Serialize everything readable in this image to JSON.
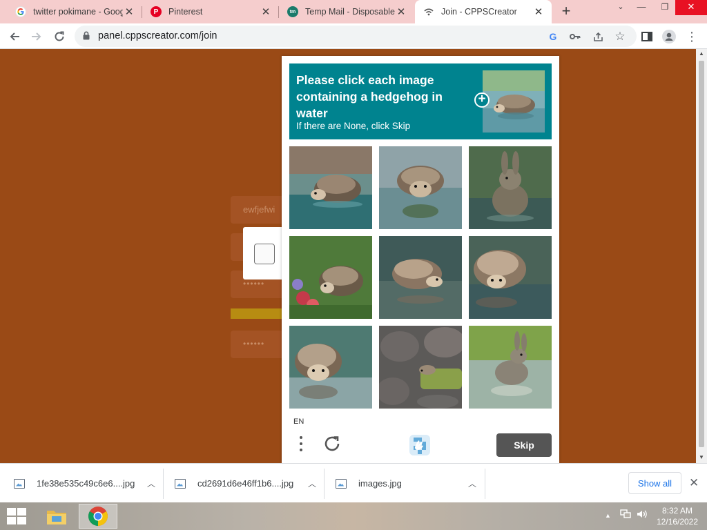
{
  "browser": {
    "tabs": [
      {
        "title": "twitter pokimane - Google",
        "favicon": "google-g-icon"
      },
      {
        "title": "Pinterest",
        "favicon": "pinterest-icon"
      },
      {
        "title": "Temp Mail - Disposable T",
        "favicon": "tempmail-icon"
      },
      {
        "title": "Join - CPPSCreator",
        "favicon": "cppscreator-icon",
        "active": true
      }
    ],
    "new_tab": "+",
    "url": "panel.cppscreator.com/join"
  },
  "page": {
    "faint_username": "ewfjefwi",
    "faint_password_1": "••••••",
    "faint_password_2": "••••••"
  },
  "captcha": {
    "prompt": "Please click each image containing a hedgehog in water",
    "subprompt": "If there are None, click Skip",
    "language": "EN",
    "skip_label": "Skip",
    "tiles": [
      {
        "subject": "hedgehog in water"
      },
      {
        "subject": "hedgehog in water"
      },
      {
        "subject": "rabbit in water"
      },
      {
        "subject": "hedgehog among flowers"
      },
      {
        "subject": "hedgehog in water"
      },
      {
        "subject": "hedgehog in water"
      },
      {
        "subject": "hedgehog in water"
      },
      {
        "subject": "hedgehog among rocks"
      },
      {
        "subject": "rabbit in water"
      }
    ],
    "colors": {
      "header": "#00838f",
      "skip_button": "#555555"
    }
  },
  "downloads": {
    "items": [
      {
        "name": "1fe38e535c49c6e6....jpg"
      },
      {
        "name": "cd2691d6e46ff1b6....jpg"
      },
      {
        "name": "images.jpg"
      }
    ],
    "show_all": "Show all"
  },
  "taskbar": {
    "time": "8:32 AM",
    "date": "12/16/2022"
  }
}
